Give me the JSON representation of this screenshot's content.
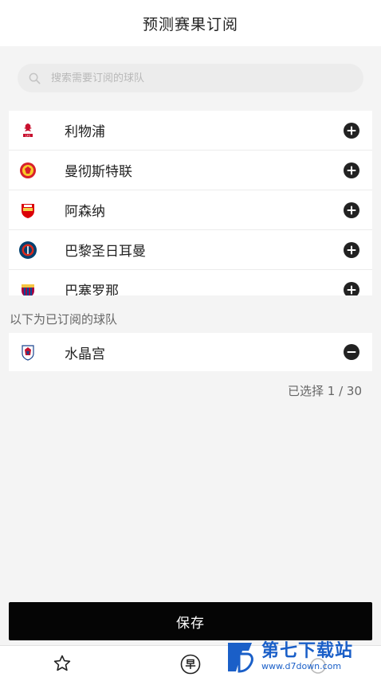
{
  "header": {
    "title": "预测赛果订阅"
  },
  "search": {
    "placeholder": "搜索需要订阅的球队",
    "value": ""
  },
  "teams": [
    {
      "name": "利物浦",
      "logo": "liverpool-logo",
      "action": "add"
    },
    {
      "name": "曼彻斯特联",
      "logo": "manchester-united-logo",
      "action": "add"
    },
    {
      "name": "阿森纳",
      "logo": "arsenal-logo",
      "action": "add"
    },
    {
      "name": "巴黎圣日耳曼",
      "logo": "psg-logo",
      "action": "add"
    },
    {
      "name": "巴塞罗那",
      "logo": "barcelona-logo",
      "action": "add"
    }
  ],
  "subscribed": {
    "title": "以下为已订阅的球队",
    "teams": [
      {
        "name": "水晶宫",
        "logo": "crystal-palace-logo",
        "action": "remove"
      }
    ]
  },
  "count": {
    "label": "已选择 1 / 30"
  },
  "save": {
    "label": "保存"
  },
  "tabbar": {
    "items": [
      {
        "icon": "star-icon"
      },
      {
        "icon": "zao-icon",
        "glyph": "早"
      },
      {
        "icon": "tab-icon"
      }
    ]
  },
  "watermark": {
    "title": "第七下载站",
    "url": "www.d7down.com"
  },
  "colors": {
    "accent": "#050505",
    "background": "#f4f4f4",
    "watermark": "#1a5fc8"
  }
}
